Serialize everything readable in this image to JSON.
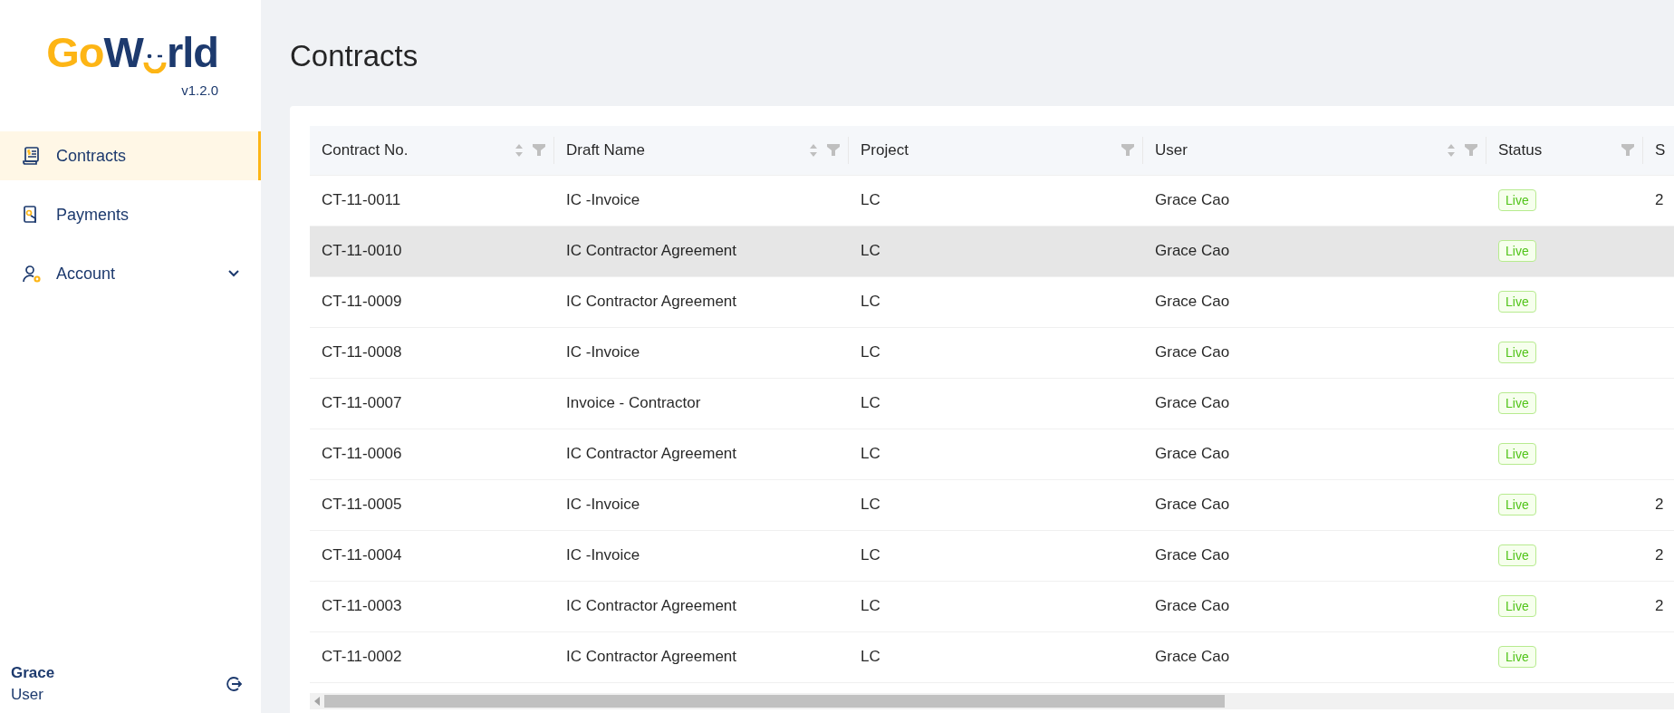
{
  "sidebar": {
    "logo": {
      "part1": "Go",
      "part2": "W",
      "part3": "rld"
    },
    "version": "v1.2.0",
    "items": [
      {
        "label": "Contracts",
        "kind": "contracts",
        "selected": true
      },
      {
        "label": "Payments",
        "kind": "payments",
        "selected": false
      },
      {
        "label": "Account",
        "kind": "account",
        "selected": false,
        "expanded": false
      }
    ],
    "user": {
      "name": "Grace",
      "role": "User"
    }
  },
  "page": {
    "title": "Contracts"
  },
  "table": {
    "columns": [
      {
        "label": "Contract No.",
        "sortable": true,
        "filterable": true
      },
      {
        "label": "Draft Name",
        "sortable": true,
        "filterable": true
      },
      {
        "label": "Project",
        "sortable": false,
        "filterable": true
      },
      {
        "label": "User",
        "sortable": true,
        "filterable": true
      },
      {
        "label": "Status",
        "sortable": false,
        "filterable": true
      },
      {
        "label": "S"
      }
    ],
    "rows": [
      {
        "hovered": false,
        "cells": [
          "CT-11-0011",
          "IC -Invoice",
          "LC",
          "Grace Cao",
          "Live",
          "2"
        ]
      },
      {
        "hovered": true,
        "cells": [
          "CT-11-0010",
          "IC Contractor Agreement",
          "LC",
          "Grace Cao",
          "Live",
          ""
        ]
      },
      {
        "hovered": false,
        "cells": [
          "CT-11-0009",
          "IC Contractor Agreement",
          "LC",
          "Grace Cao",
          "Live",
          ""
        ]
      },
      {
        "hovered": false,
        "cells": [
          "CT-11-0008",
          "IC -Invoice",
          "LC",
          "Grace Cao",
          "Live",
          ""
        ]
      },
      {
        "hovered": false,
        "cells": [
          "CT-11-0007",
          "Invoice - Contractor",
          "LC",
          "Grace Cao",
          "Live",
          ""
        ]
      },
      {
        "hovered": false,
        "cells": [
          "CT-11-0006",
          "IC Contractor Agreement",
          "LC",
          "Grace Cao",
          "Live",
          ""
        ]
      },
      {
        "hovered": false,
        "cells": [
          "CT-11-0005",
          "IC -Invoice",
          "LC",
          "Grace Cao",
          "Live",
          "2"
        ]
      },
      {
        "hovered": false,
        "cells": [
          "CT-11-0004",
          "IC -Invoice",
          "LC",
          "Grace Cao",
          "Live",
          "2"
        ]
      },
      {
        "hovered": false,
        "cells": [
          "CT-11-0003",
          "IC Contractor Agreement",
          "LC",
          "Grace Cao",
          "Live",
          "2"
        ]
      },
      {
        "hovered": false,
        "cells": [
          "CT-11-0002",
          "IC Contractor Agreement",
          "LC",
          "Grace Cao",
          "Live",
          ""
        ]
      }
    ]
  }
}
